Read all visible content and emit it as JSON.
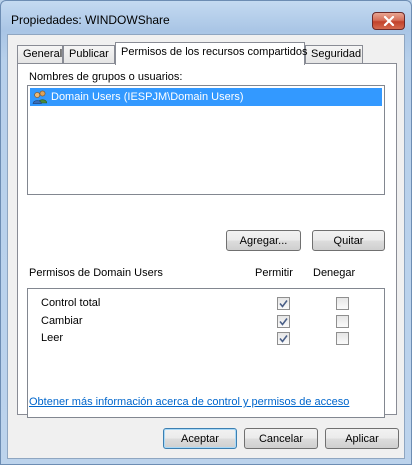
{
  "window": {
    "title": "Propiedades: WINDOWShare"
  },
  "tabs": [
    {
      "label": "General"
    },
    {
      "label": "Publicar"
    },
    {
      "label": "Permisos de los recursos compartidos"
    },
    {
      "label": "Seguridad"
    }
  ],
  "groups": {
    "label": "Nombres de grupos o usuarios:",
    "items": [
      {
        "label": "Domain Users (IESPJM\\Domain Users)",
        "icon": "users-group-icon"
      }
    ]
  },
  "buttons": {
    "add": "Agregar...",
    "remove": "Quitar",
    "ok": "Aceptar",
    "cancel": "Cancelar",
    "apply": "Aplicar"
  },
  "permissions": {
    "label": "Permisos de Domain Users",
    "allow_header": "Permitir",
    "deny_header": "Denegar",
    "rows": [
      {
        "name": "Control total",
        "allow": true,
        "deny": false
      },
      {
        "name": "Cambiar",
        "allow": true,
        "deny": false
      },
      {
        "name": "Leer",
        "allow": true,
        "deny": false
      }
    ]
  },
  "link": {
    "text": "Obtener más información acerca de control y permisos de acceso"
  },
  "colors": {
    "selection": "#3399ff",
    "link": "#0066cc",
    "close": "#c2422b"
  }
}
